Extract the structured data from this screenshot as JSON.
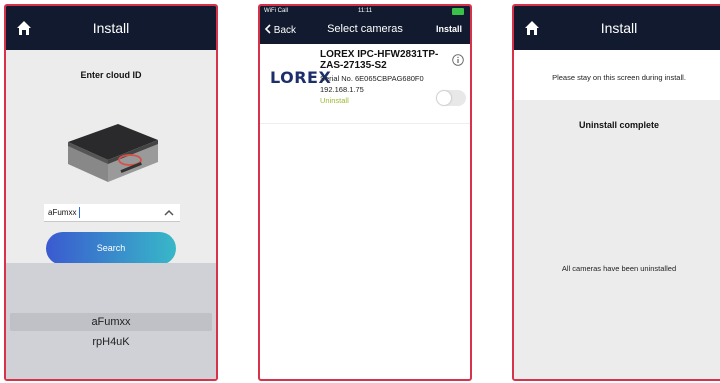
{
  "screen1": {
    "header_title": "Install",
    "heading": "Enter cloud ID",
    "input_value": "aFumxx",
    "search_label": "Search",
    "picker_items": [
      "aFumxx",
      "rpH4uK"
    ]
  },
  "screen2": {
    "status": {
      "carrier": "WiFi Call",
      "time": "11:11"
    },
    "back_label": "Back",
    "header_title": "Select cameras",
    "install_label": "Install",
    "logo_text": "LOREX",
    "camera": {
      "name": "LOREX IPC-HFW2831TP-ZAS-27135-S2",
      "serial": "Serial No. 6E065CBPAG680F0",
      "ip": "192.168.1.75",
      "status": "Uninstall"
    }
  },
  "screen3": {
    "header_title": "Install",
    "message": "Please stay on this screen during install.",
    "complete": "Uninstall complete",
    "all_uninstalled": "All cameras have been uninstalled"
  },
  "colors": {
    "frame": "#d6324a",
    "header": "#111a2e",
    "gradient_start": "#3a5ad0",
    "gradient_end": "#38b8c8",
    "status_green": "#9bb735"
  }
}
